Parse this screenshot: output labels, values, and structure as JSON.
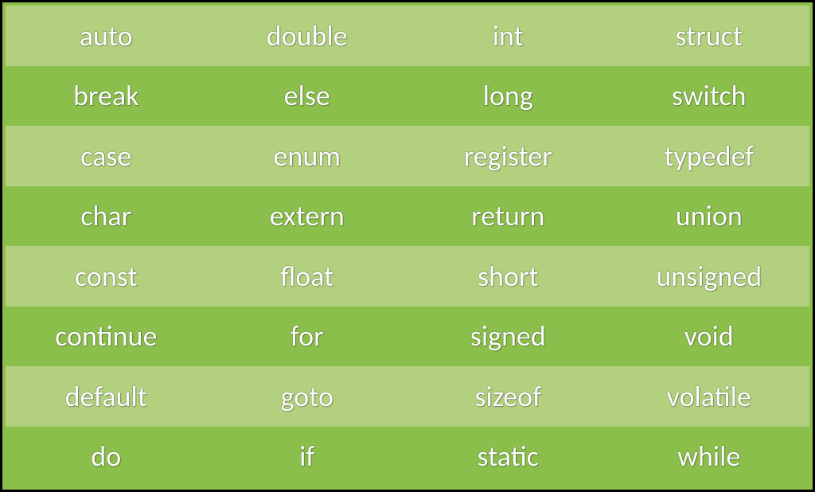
{
  "table": {
    "colors": {
      "light": "#b2d07e",
      "dark": "#8bbf4b",
      "text": "#ffffff",
      "border": "#000000"
    },
    "rows": [
      {
        "shade": "light",
        "cells": [
          "auto",
          "double",
          "int",
          "struct"
        ]
      },
      {
        "shade": "dark",
        "cells": [
          "break",
          "else",
          "long",
          "switch"
        ]
      },
      {
        "shade": "light",
        "cells": [
          "case",
          "enum",
          "register",
          "typedef"
        ]
      },
      {
        "shade": "dark",
        "cells": [
          "char",
          "extern",
          "return",
          "union"
        ]
      },
      {
        "shade": "light",
        "cells": [
          "const",
          "float",
          "short",
          "unsigned"
        ]
      },
      {
        "shade": "dark",
        "cells": [
          "continue",
          "for",
          "signed",
          "void"
        ]
      },
      {
        "shade": "light",
        "cells": [
          "default",
          "goto",
          "sizeof",
          "volatile"
        ]
      },
      {
        "shade": "dark",
        "cells": [
          "do",
          "if",
          "static",
          "while"
        ]
      }
    ]
  }
}
